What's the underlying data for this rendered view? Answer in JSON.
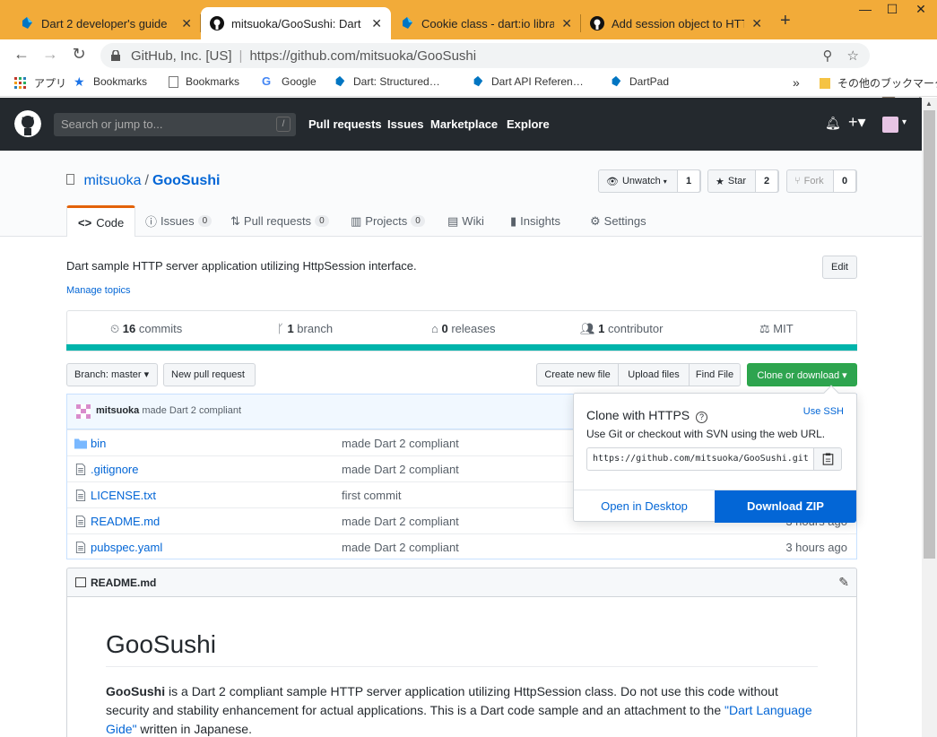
{
  "browser": {
    "tabs": [
      {
        "title": "Dart 2 developer's guide",
        "icon": "dart-icon"
      },
      {
        "title": "mitsuoka/GooSushi: Dart sample",
        "icon": "github-icon"
      },
      {
        "title": "Cookie class - dart:io library",
        "icon": "dart-icon"
      },
      {
        "title": "Add session object to HTTP",
        "icon": "github-icon"
      }
    ],
    "address": {
      "org": "GitHub, Inc. [US]",
      "url": "https://github.com/mitsuoka/GooSushi"
    },
    "bookmarks": [
      {
        "label": "アプリ"
      },
      {
        "label": "Bookmarks"
      },
      {
        "label": "Bookmarks"
      },
      {
        "label": "Google"
      },
      {
        "label": "Dart: Structured…"
      },
      {
        "label": "Dart API Referen…"
      },
      {
        "label": "DartPad"
      }
    ],
    "other_bookmarks": "その他のブックマーク",
    "chevron": "»"
  },
  "github": {
    "search_placeholder": "Search or jump to...",
    "slash": "/",
    "nav": [
      "Pull requests",
      "Issues",
      "Marketplace",
      "Explore"
    ]
  },
  "repo": {
    "owner": "mitsuoka",
    "name": "GooSushi",
    "unwatch": "Unwatch",
    "unwatch_count": "1",
    "star": "Star",
    "star_count": "2",
    "fork": "Fork",
    "fork_count": "0",
    "tabs": {
      "code": "Code",
      "issues": "Issues",
      "issues_count": "0",
      "pulls": "Pull requests",
      "pulls_count": "0",
      "projects": "Projects",
      "projects_count": "0",
      "wiki": "Wiki",
      "insights": "Insights",
      "settings": "Settings"
    },
    "description": "Dart sample HTTP server application utilizing HttpSession interface.",
    "manage_topics": "Manage topics",
    "edit": "Edit",
    "summary": {
      "commits_n": "16",
      "commits": "commits",
      "branch_n": "1",
      "branch": "branch",
      "releases_n": "0",
      "releases": "releases",
      "contributor_n": "1",
      "contributor": "contributor",
      "license": "MIT"
    },
    "branch_btn": "Branch: master ▾",
    "new_pr": "New pull request",
    "create_file": "Create new file",
    "upload": "Upload files",
    "find": "Find File",
    "clone": "Clone or download ▾",
    "latest_commit_author": "mitsuoka",
    "latest_commit_msg": "made Dart 2 compliant",
    "files": [
      {
        "name": "bin",
        "type": "folder",
        "msg": "made Dart 2 compliant",
        "age": ""
      },
      {
        "name": ".gitignore",
        "type": "file",
        "msg": "made Dart 2 compliant",
        "age": ""
      },
      {
        "name": "LICENSE.txt",
        "type": "file",
        "msg": "first commit",
        "age": ""
      },
      {
        "name": "README.md",
        "type": "file",
        "msg": "made Dart 2 compliant",
        "age": "3 hours ago"
      },
      {
        "name": "pubspec.yaml",
        "type": "file",
        "msg": "made Dart 2 compliant",
        "age": "3 hours ago"
      }
    ]
  },
  "clone_popover": {
    "title": "Clone with HTTPS",
    "help": "?",
    "use_ssh": "Use SSH",
    "sub": "Use Git or checkout with SVN using the web URL.",
    "url": "https://github.com/mitsuoka/GooSushi.git",
    "open_desktop": "Open in Desktop",
    "download_zip": "Download ZIP"
  },
  "readme": {
    "file": "README.md",
    "h1": "GooSushi",
    "p_bold": "GooSushi",
    "p_text": " is a Dart 2 compliant sample HTTP server application utilizing HttpSession class. Do not use this code without security and stability enhancement for actual applications. This is a Dart code sample and an attachment to the ",
    "p_link": "\"Dart Language Gide\"",
    "p_tail": " written in Japanese."
  },
  "colors": {
    "github_dark": "#24292e",
    "link": "#0366d6",
    "green": "#2ea44f",
    "lang_dart": "#00b4ab",
    "tab_strip": "#f2ab39"
  }
}
